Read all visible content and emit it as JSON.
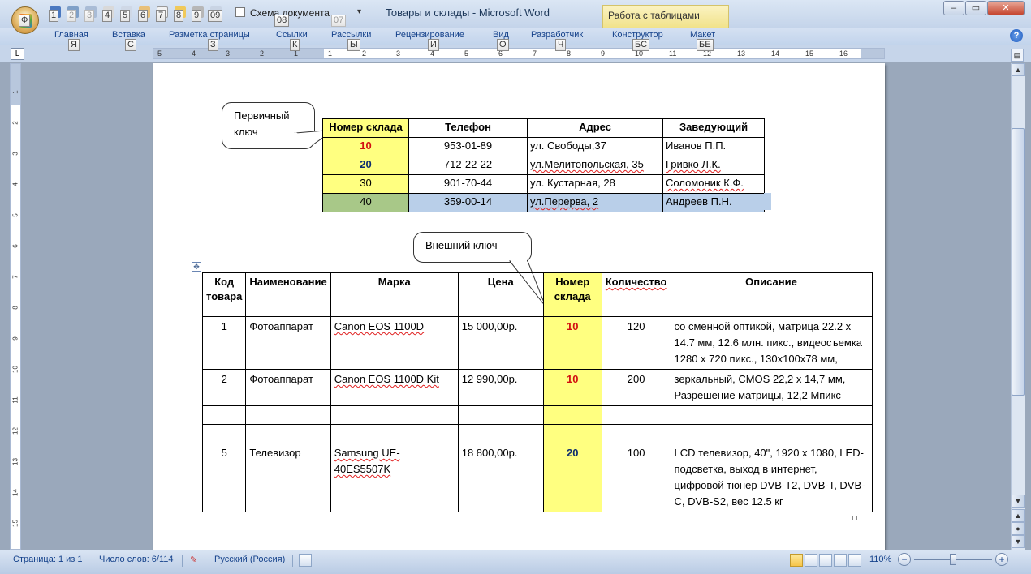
{
  "window": {
    "title": "Товары и склады - Microsoft Word",
    "context_tab": "Работа с таблицами",
    "controls": [
      "–",
      "▭",
      "✕"
    ]
  },
  "office_button": {
    "keytip": "Ф"
  },
  "quick_access": {
    "keytips": [
      "1",
      "2",
      "3",
      "4",
      "5",
      "6",
      "7",
      "8",
      "9",
      "09"
    ],
    "checkbox_label": "Схема документа",
    "checkbox_keytip": "08",
    "extra_keytip": "07",
    "more": "▾"
  },
  "ribbon_tabs": [
    {
      "label": "Главная",
      "keytip": "Я"
    },
    {
      "label": "Вставка",
      "keytip": "С"
    },
    {
      "label": "Разметка страницы",
      "keytip": "З"
    },
    {
      "label": "Ссылки",
      "keytip": "К"
    },
    {
      "label": "Рассылки",
      "keytip": "Ы"
    },
    {
      "label": "Рецензирование",
      "keytip": "И"
    },
    {
      "label": "Вид",
      "keytip": "О"
    },
    {
      "label": "Разработчик",
      "keytip": "Ч"
    },
    {
      "label": "Конструктор",
      "keytip": "БС"
    },
    {
      "label": "Макет",
      "keytip": "БЕ"
    }
  ],
  "hruler": {
    "corner": "L",
    "labels": [
      "5",
      "4",
      "3",
      "2",
      "1",
      "1",
      "2",
      "3",
      "4",
      "5",
      "6",
      "7",
      "8",
      "9",
      "10",
      "11",
      "12",
      "13",
      "14",
      "15",
      "16"
    ]
  },
  "vruler": {
    "labels": [
      "1",
      "2",
      "3",
      "4",
      "5",
      "6",
      "7",
      "8",
      "9",
      "10",
      "11",
      "12",
      "13",
      "14",
      "15"
    ]
  },
  "callouts": {
    "primary_key": "Первичный ключ",
    "foreign_key": "Внешний ключ"
  },
  "warehouses": {
    "headers": [
      "Номер склада",
      "Телефон",
      "Адрес",
      "Заведующий"
    ],
    "rows": [
      [
        "10",
        "953-01-89",
        "ул. Свободы,37",
        "Иванов П.П."
      ],
      [
        "20",
        "712-22-22",
        "ул.Мелитопольская, 35",
        "Гривко Л.К."
      ],
      [
        "30",
        "901-70-44",
        "ул. Кустарная, 28",
        "Соломоник К.Ф."
      ],
      [
        "40",
        "359-00-14",
        "ул.Перерва, 2",
        "Андреев П.Н."
      ]
    ]
  },
  "products": {
    "headers": [
      "Код товара",
      "Наименование",
      "Марка",
      "Цена",
      "Номер склада",
      "Количество",
      "Описание"
    ],
    "rows": [
      [
        "1",
        "Фотоаппарат",
        "Canon EOS 1100D",
        "15 000,00р.",
        "10",
        "120",
        "со сменной оптикой,  матрица 22.2 x 14.7 мм, 12.6 млн. пикс., видеосъемка 1280 x 720 пикс., 130x100x78 мм,"
      ],
      [
        "2",
        "Фотоаппарат",
        "Canon EOS 1100D  Kit",
        "12 990,00р.",
        "10",
        "200",
        "зеркальный, CMOS 22,2 x 14,7 мм, Разрешение матрицы, 12,2 Мпикс"
      ],
      [
        "",
        "",
        "",
        "",
        "",
        "",
        ""
      ],
      [
        "",
        "",
        "",
        "",
        "",
        "",
        ""
      ],
      [
        "5",
        "Телевизор",
        "Samsung UE-40ES5507K",
        "18 800,00р.",
        "20",
        "100",
        "LCD телевизор, 40\", 1920 x 1080, LED-подсветка, выход в интернет, цифровой тюнер DVB-T2, DVB-T, DVB-C, DVB-S2, вес 12.5 кг"
      ]
    ]
  },
  "status": {
    "page": "Страница: 1 из 1",
    "words": "Число слов: 6/114",
    "language": "Русский (Россия)",
    "zoom": "110%",
    "zoom_minus": "−",
    "zoom_plus": "+"
  },
  "colors": {
    "key_highlight": "#ffff80",
    "key_red": "#d21010",
    "key_navy": "#0e2d6e",
    "selection": "#b9cfe9"
  }
}
